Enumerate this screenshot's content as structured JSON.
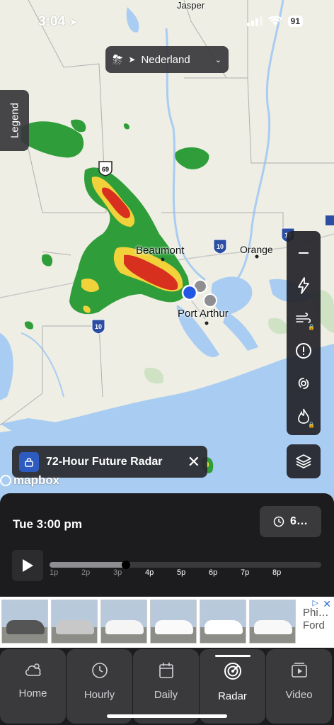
{
  "status_bar": {
    "time": "3:04",
    "battery": "91"
  },
  "location": {
    "name": "Nederland"
  },
  "legend": {
    "label": "Legend"
  },
  "map": {
    "cities": {
      "jasper": "Jasper",
      "beaumont": "Beaumont",
      "orange": "Orange",
      "port_arthur": "Port Arthur"
    },
    "highways": {
      "us69": "69",
      "i10_east": "10",
      "i10_west": "10",
      "i10_far": "10"
    },
    "attribution": "mapbox"
  },
  "future_radar": {
    "label": "72-Hour Future Radar"
  },
  "timeline": {
    "current_time": "Tue 3:00 pm",
    "time_button": "6…",
    "progress": 0.28,
    "ticks": [
      "1p",
      "2p",
      "3p",
      "4p",
      "5p",
      "6p",
      "7p",
      "8p"
    ]
  },
  "ad": {
    "brand_line1": "Phi…",
    "brand_line2": "Ford"
  },
  "nav": {
    "items": [
      {
        "label": "Home",
        "icon": "cloud-icon"
      },
      {
        "label": "Hourly",
        "icon": "clock-icon"
      },
      {
        "label": "Daily",
        "icon": "calendar-icon"
      },
      {
        "label": "Radar",
        "icon": "radar-icon"
      },
      {
        "label": "Video",
        "icon": "video-icon"
      }
    ],
    "active": "Radar"
  },
  "colors": {
    "water": "#a9cdf2",
    "land": "#eeeee4",
    "radar_green": "#2f9e3a",
    "radar_yellow": "#f2d23a",
    "radar_red": "#d7301f",
    "location_dot": "#2456e6",
    "accent_blue": "#2d5bbf"
  }
}
